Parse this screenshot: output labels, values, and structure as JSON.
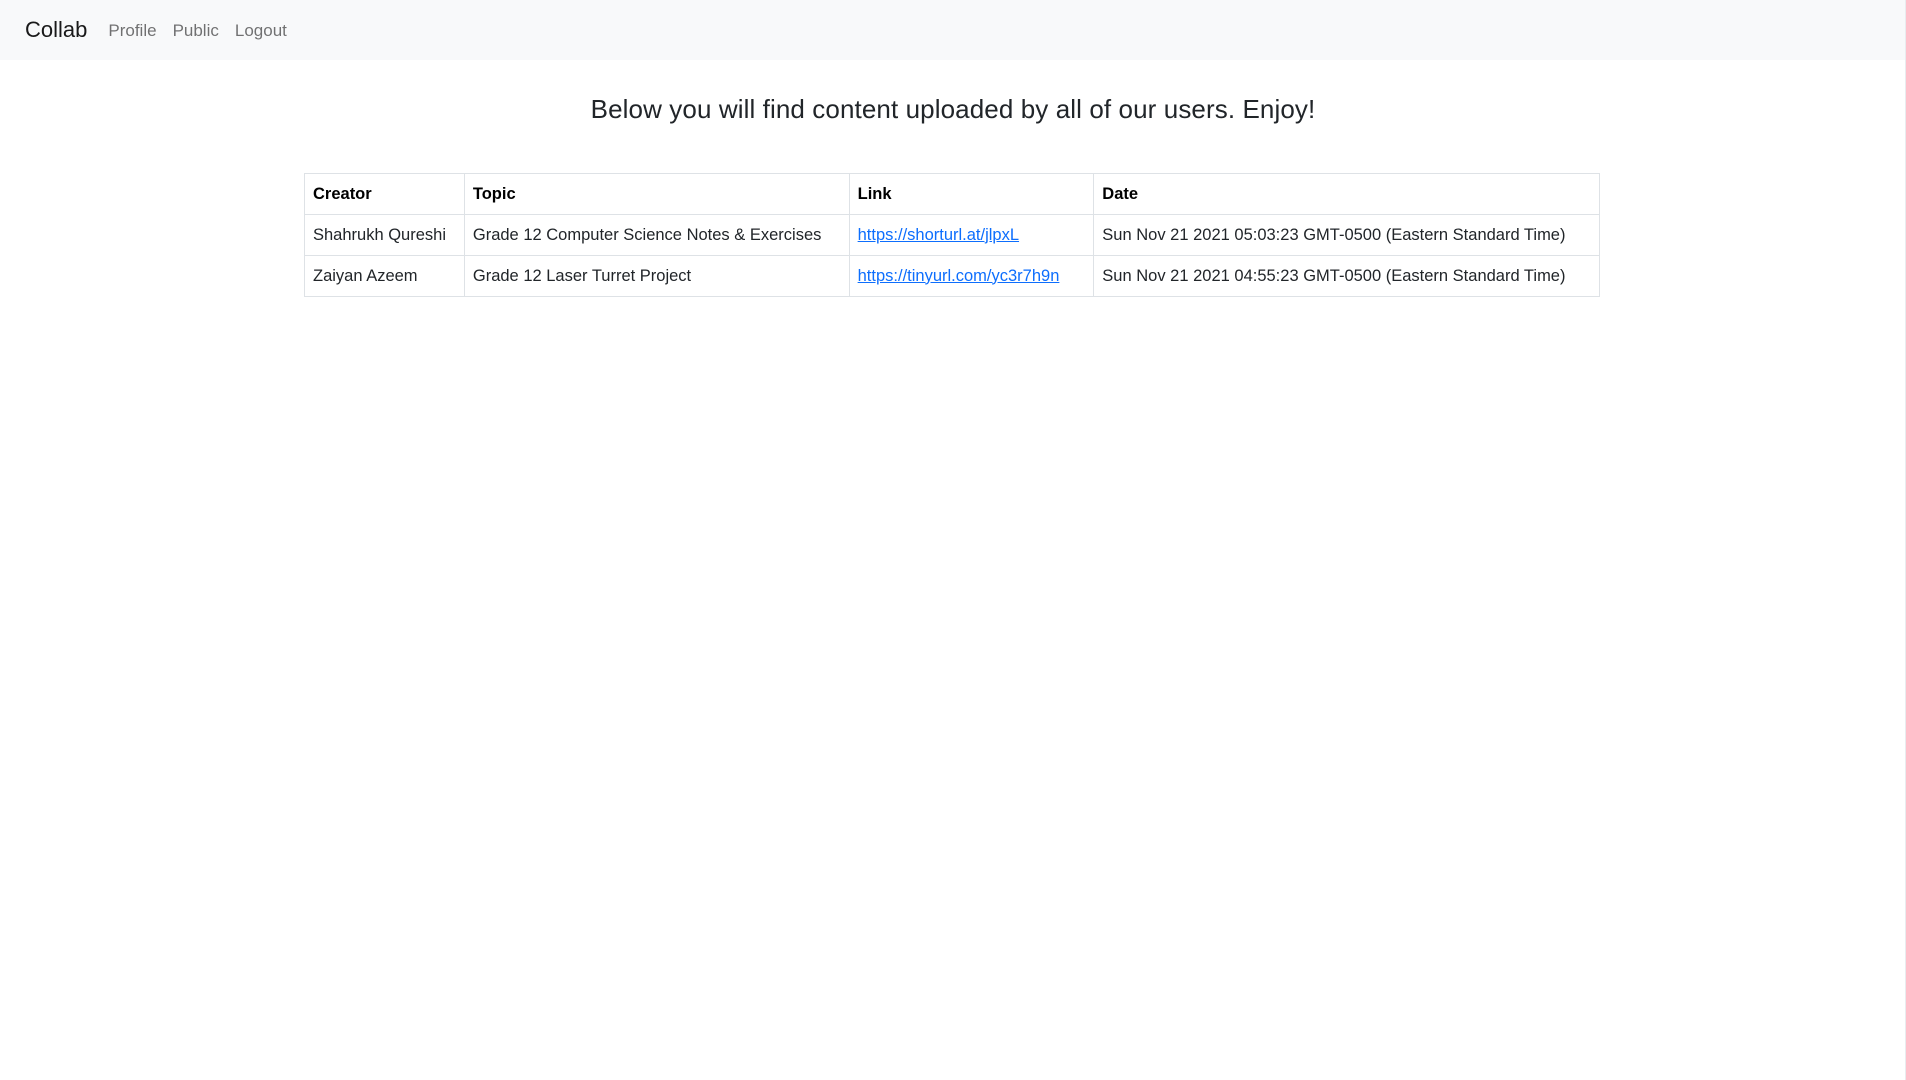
{
  "navbar": {
    "brand": "Collab",
    "links": [
      {
        "label": "Profile"
      },
      {
        "label": "Public"
      },
      {
        "label": "Logout"
      }
    ]
  },
  "main": {
    "heading": "Below you will find content uploaded by all of our users. Enjoy!"
  },
  "table": {
    "headers": {
      "creator": "Creator",
      "topic": "Topic",
      "link": "Link",
      "date": "Date"
    },
    "rows": [
      {
        "creator": "Shahrukh Qureshi",
        "topic": "Grade 12 Computer Science Notes & Exercises",
        "link": "https://shorturl.at/jlpxL",
        "date": "Sun Nov 21 2021 05:03:23 GMT-0500 (Eastern Standard Time)"
      },
      {
        "creator": "Zaiyan Azeem",
        "topic": "Grade 12 Laser Turret Project",
        "link": "https://tinyurl.com/yc3r7h9n",
        "date": "Sun Nov 21 2021 04:55:23 GMT-0500 (Eastern Standard Time)"
      }
    ]
  },
  "colors": {
    "navbar_bg": "#f8f9fa",
    "link": "#0d6efd",
    "border": "#dee2e6",
    "text": "#212529"
  }
}
